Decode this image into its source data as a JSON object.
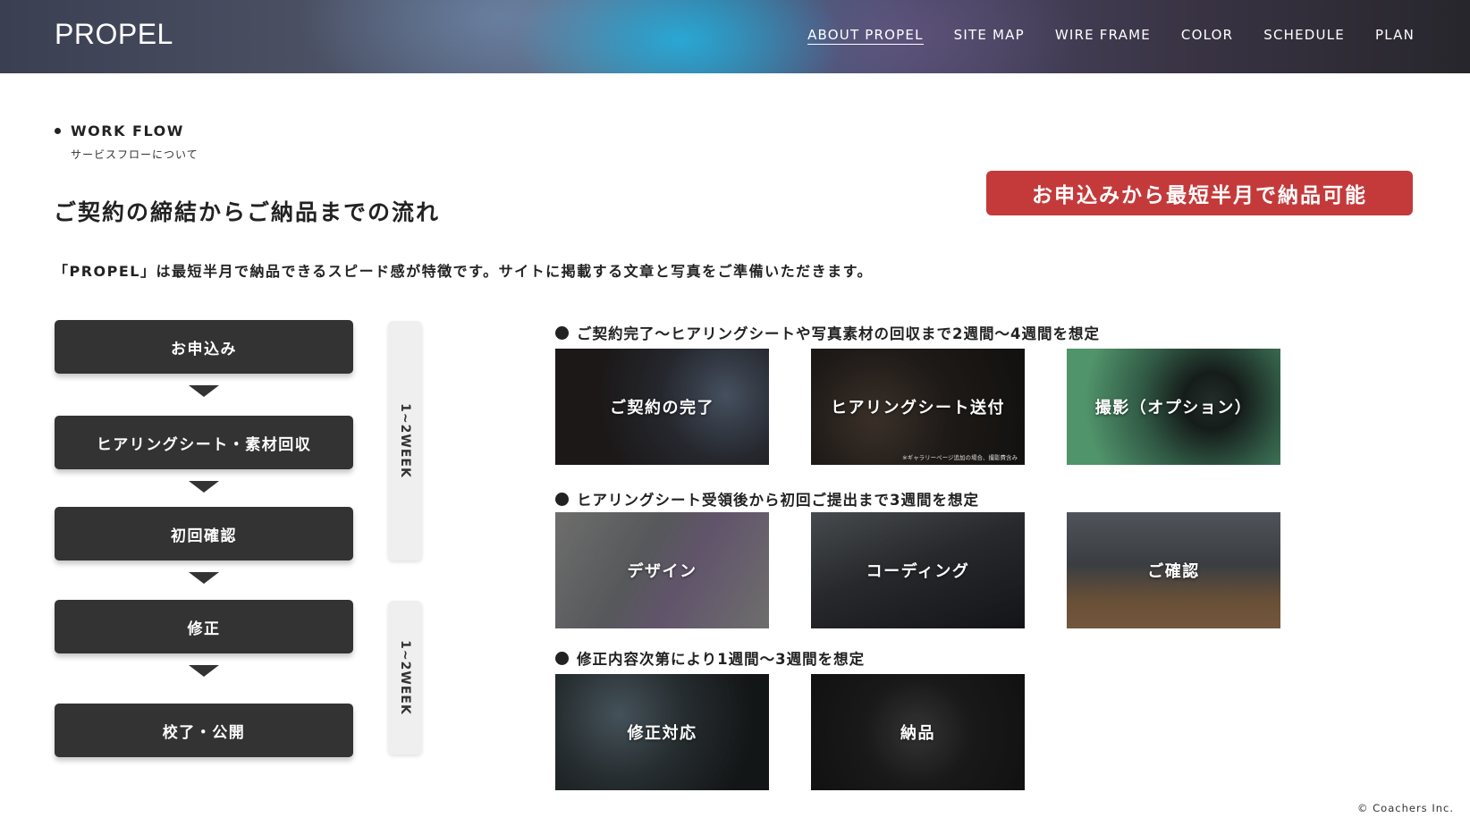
{
  "header": {
    "logo": "PROPEL",
    "nav": [
      "ABOUT PROPEL",
      "SITE MAP",
      "WIRE FRAME",
      "COLOR",
      "SCHEDULE",
      "PLAN"
    ],
    "active_nav": "ABOUT PROPEL"
  },
  "section": {
    "title": "WORK FLOW",
    "subtitle": "サービスフローについて"
  },
  "main_title": "ご契約の締結からご納品までの流れ",
  "badge": "お申込みから最短半月で納品可能",
  "description": "「PROPEL」は最短半月で納品できるスピード感が特徴です。サイトに掲載する文章と写真をご準備いただきます。",
  "steps": [
    "お申込み",
    "ヒアリングシート・素材回収",
    "初回確認",
    "修正",
    "校了・公開"
  ],
  "weeks": [
    "1~2WEEK",
    "1~2WEEK"
  ],
  "phases": [
    {
      "title": "ご契約完了〜ヒアリングシートや写真素材の回収まで2週間〜4週間を想定",
      "cards": [
        {
          "label": "ご契約の完了",
          "note": ""
        },
        {
          "label": "ヒアリングシート送付",
          "note": "※ギャラリーページ追加の場合、撮影費含み"
        },
        {
          "label": "撮影（オプション）",
          "note": ""
        }
      ]
    },
    {
      "title": "ヒアリングシート受領後から初回ご提出まで3週間を想定",
      "cards": [
        {
          "label": "デザイン",
          "note": ""
        },
        {
          "label": "コーディング",
          "note": ""
        },
        {
          "label": "ご確認",
          "note": ""
        }
      ]
    },
    {
      "title": "修正内容次第により1週間〜3週間を想定",
      "cards": [
        {
          "label": "修正対応",
          "note": ""
        },
        {
          "label": "納品",
          "note": ""
        }
      ]
    }
  ],
  "copyright": "© Coachers Inc.",
  "colors": {
    "accent_red": "#c43a3a",
    "step_dark": "#333333",
    "week_bar": "#efefef"
  }
}
